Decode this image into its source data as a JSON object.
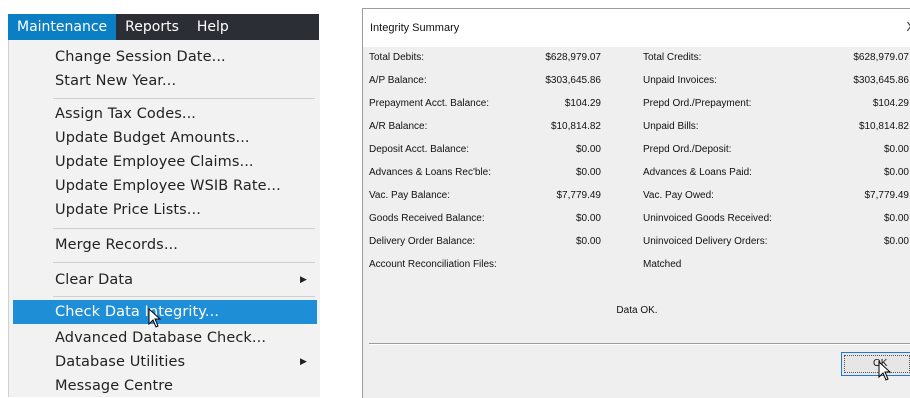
{
  "menubar": {
    "items": [
      "Maintenance",
      "Reports",
      "Help"
    ]
  },
  "menu": {
    "items": [
      "Change Session Date...",
      "Start New Year...",
      "Assign Tax Codes...",
      "Update Budget Amounts...",
      "Update Employee Claims...",
      "Update Employee WSIB Rate...",
      "Update Price Lists...",
      "Merge Records...",
      "Clear Data",
      "Check Data Integrity...",
      "Advanced Database Check...",
      "Database Utilities",
      "Message Centre"
    ],
    "submenu_arrow": "▶"
  },
  "dialog": {
    "title": "Integrity Summary",
    "close_glyph": "X",
    "rows": [
      {
        "left_label": "Total Debits:",
        "left_value": "$628,979.07",
        "right_label": "Total Credits:",
        "right_value": "$628,979.07"
      },
      {
        "left_label": "A/P Balance:",
        "left_value": "$303,645.86",
        "right_label": "Unpaid Invoices:",
        "right_value": "$303,645.86"
      },
      {
        "left_label": "Prepayment Acct. Balance:",
        "left_value": "$104.29",
        "right_label": "Prepd Ord./Prepayment:",
        "right_value": "$104.29"
      },
      {
        "left_label": "A/R Balance:",
        "left_value": "$10,814.82",
        "right_label": "Unpaid Bills:",
        "right_value": "$10,814.82"
      },
      {
        "left_label": "Deposit Acct. Balance:",
        "left_value": "$0.00",
        "right_label": "Prepd Ord./Deposit:",
        "right_value": "$0.00"
      },
      {
        "left_label": "Advances & Loans Rec'ble:",
        "left_value": "$0.00",
        "right_label": "Advances & Loans Paid:",
        "right_value": "$0.00"
      },
      {
        "left_label": "Vac. Pay Balance:",
        "left_value": "$7,779.49",
        "right_label": "Vac. Pay Owed:",
        "right_value": "$7,779.49"
      },
      {
        "left_label": "Goods Received Balance:",
        "left_value": "$0.00",
        "right_label": "Uninvoiced Goods Received:",
        "right_value": "$0.00"
      },
      {
        "left_label": "Delivery Order Balance:",
        "left_value": "$0.00",
        "right_label": "Uninvoiced Delivery Orders:",
        "right_value": "$0.00"
      },
      {
        "left_label": "Account Reconciliation Files:",
        "left_value": "",
        "right_label": "Matched",
        "right_value": ""
      }
    ],
    "status": "Data OK.",
    "ok_label": "OK"
  },
  "colors": {
    "menubar_bg": "#2b2f35",
    "menubar_active": "#0a7fc4",
    "menu_selected": "#1e8fd6",
    "dialog_body": "#efefef"
  }
}
